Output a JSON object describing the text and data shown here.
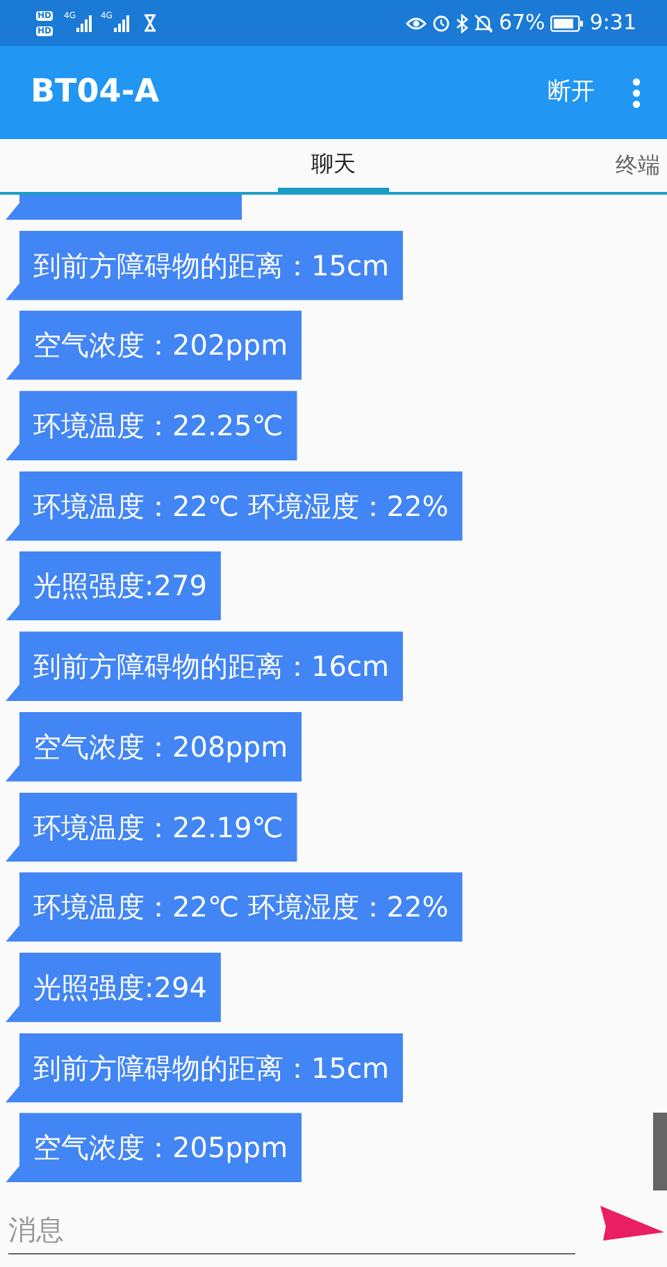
{
  "status_bar": {
    "hd_labels": [
      "HD",
      "HD"
    ],
    "network_labels": [
      "4G",
      "4G"
    ],
    "battery": "67%",
    "time": "9:31"
  },
  "app_bar": {
    "title": "BT04-A",
    "action": "断开"
  },
  "tabs": [
    {
      "label": "聊天",
      "selected": true
    },
    {
      "label": "终端",
      "selected": false
    }
  ],
  "messages": [
    "到前方障碍物的距离：15cm",
    "空气浓度：202ppm",
    "环境温度：22.25℃",
    "环境温度：22℃ 环境湿度：22%",
    "光照强度:279",
    "到前方障碍物的距离：16cm",
    "空气浓度：208ppm",
    "环境温度：22.19℃",
    "环境温度：22℃ 环境湿度：22%",
    "光照强度:294",
    "到前方障碍物的距离：15cm",
    "空气浓度：205ppm"
  ],
  "input": {
    "placeholder": "消息"
  }
}
